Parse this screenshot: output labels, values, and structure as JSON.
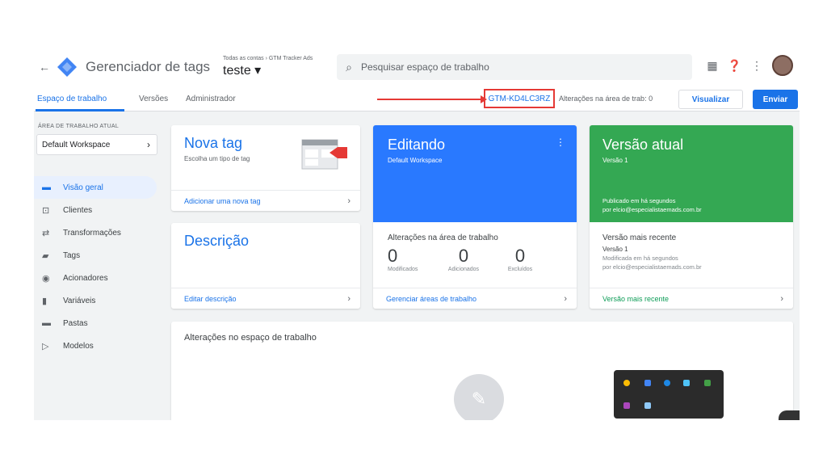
{
  "topbar": {
    "app_title": "Gerenciador de tags",
    "breadcrumb": "Todas as contas › GTM Tracker Ads",
    "container": "teste ▾",
    "search_placeholder": "Pesquisar espaço de trabalho"
  },
  "tabs": {
    "workspace": "Espaço de trabalho",
    "versions": "Versões",
    "admin": "Administrador",
    "gtm_id": "GTM-KD4LC3RZ",
    "changes": "Alterações na área de trab: 0",
    "preview": "Visualizar",
    "submit": "Enviar"
  },
  "sidebar": {
    "workspace_label": "ÁREA DE TRABALHO ATUAL",
    "workspace_name": "Default Workspace",
    "items": [
      {
        "label": "Visão geral",
        "icon": "folder-icon"
      },
      {
        "label": "Clientes",
        "icon": "client-icon"
      },
      {
        "label": "Transformações",
        "icon": "transform-icon"
      },
      {
        "label": "Tags",
        "icon": "tag-icon"
      },
      {
        "label": "Acionadores",
        "icon": "trigger-icon"
      },
      {
        "label": "Variáveis",
        "icon": "variable-icon"
      },
      {
        "label": "Pastas",
        "icon": "folder-icon"
      },
      {
        "label": "Modelos",
        "icon": "template-icon"
      }
    ]
  },
  "cards": {
    "new_tag": {
      "title": "Nova tag",
      "subtitle": "Escolha um tipo de tag",
      "footer": "Adicionar uma nova tag"
    },
    "editing": {
      "title": "Editando",
      "subtitle": "Default Workspace"
    },
    "current_version": {
      "title": "Versão atual",
      "subtitle": "Versão 1",
      "published": "Publicado em há segundos",
      "by": "por elcio@especialistaemads.com.br"
    },
    "description": {
      "title": "Descrição",
      "footer": "Editar descrição"
    },
    "workspace_changes": {
      "title": "Alterações na área de trabalho",
      "counts": [
        {
          "num": "0",
          "label": "Modificados"
        },
        {
          "num": "0",
          "label": "Adicionados"
        },
        {
          "num": "0",
          "label": "Excluídos"
        }
      ],
      "footer": "Gerenciar áreas de trabalho"
    },
    "latest_version": {
      "title": "Versão mais recente",
      "version": "Versão 1",
      "modified": "Modificada em há segundos",
      "by": "por elcio@especialistaemads.com.br",
      "footer": "Versão mais recente"
    },
    "changes_panel": {
      "title": "Alterações no espaço de trabalho"
    }
  },
  "colors": {
    "accent": "#1a73e8",
    "editing": "#2979ff",
    "version": "#34a853",
    "highlight": "#e53935"
  }
}
